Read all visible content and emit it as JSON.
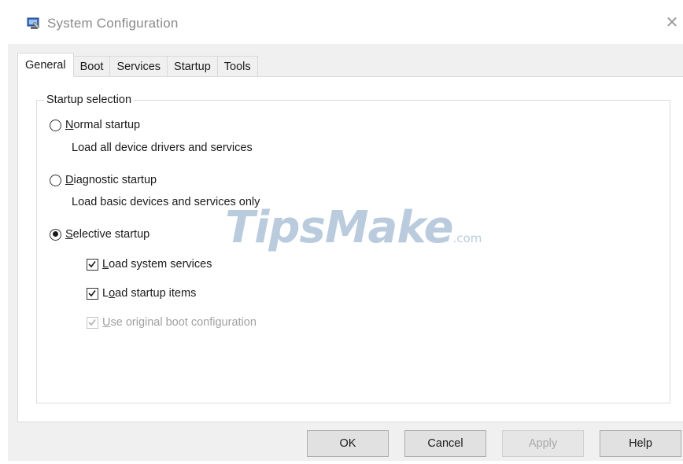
{
  "window": {
    "title": "System Configuration",
    "close_glyph": "✕"
  },
  "tabs": [
    {
      "label": "General",
      "active": true
    },
    {
      "label": "Boot",
      "active": false
    },
    {
      "label": "Services",
      "active": false
    },
    {
      "label": "Startup",
      "active": false
    },
    {
      "label": "Tools",
      "active": false
    }
  ],
  "startup_selection": {
    "legend": "Startup selection",
    "normal": {
      "mnemonic": "N",
      "rest": "ormal startup",
      "description": "Load all device drivers and services",
      "selected": false
    },
    "diagnostic": {
      "mnemonic": "D",
      "rest": "iagnostic startup",
      "description": "Load basic devices and services only",
      "selected": false
    },
    "selective": {
      "mnemonic": "S",
      "rest": "elective startup",
      "selected": true
    },
    "options": {
      "system_services": {
        "mnemonic": "L",
        "rest": "oad system services",
        "checked": true,
        "enabled": true
      },
      "startup_items": {
        "pre": "L",
        "mnemonic": "o",
        "rest": "ad startup items",
        "checked": true,
        "enabled": true
      },
      "original_boot": {
        "mnemonic": "U",
        "rest": "se original boot configuration",
        "checked": true,
        "enabled": false
      }
    }
  },
  "watermark": {
    "brand": "TipsMake",
    "suffix": ".com"
  },
  "buttons": {
    "ok": "OK",
    "cancel": "Cancel",
    "apply": "Apply",
    "help": "Help"
  },
  "icons": {
    "app": "msconfig-app-icon",
    "close": "close-icon"
  },
  "colors": {
    "title_text": "#8a8a8a",
    "dialog_bg": "#f0f0f0",
    "panel_bg": "#ffffff",
    "disabled_text": "#a0a0a0",
    "watermark": "#648cb4"
  }
}
